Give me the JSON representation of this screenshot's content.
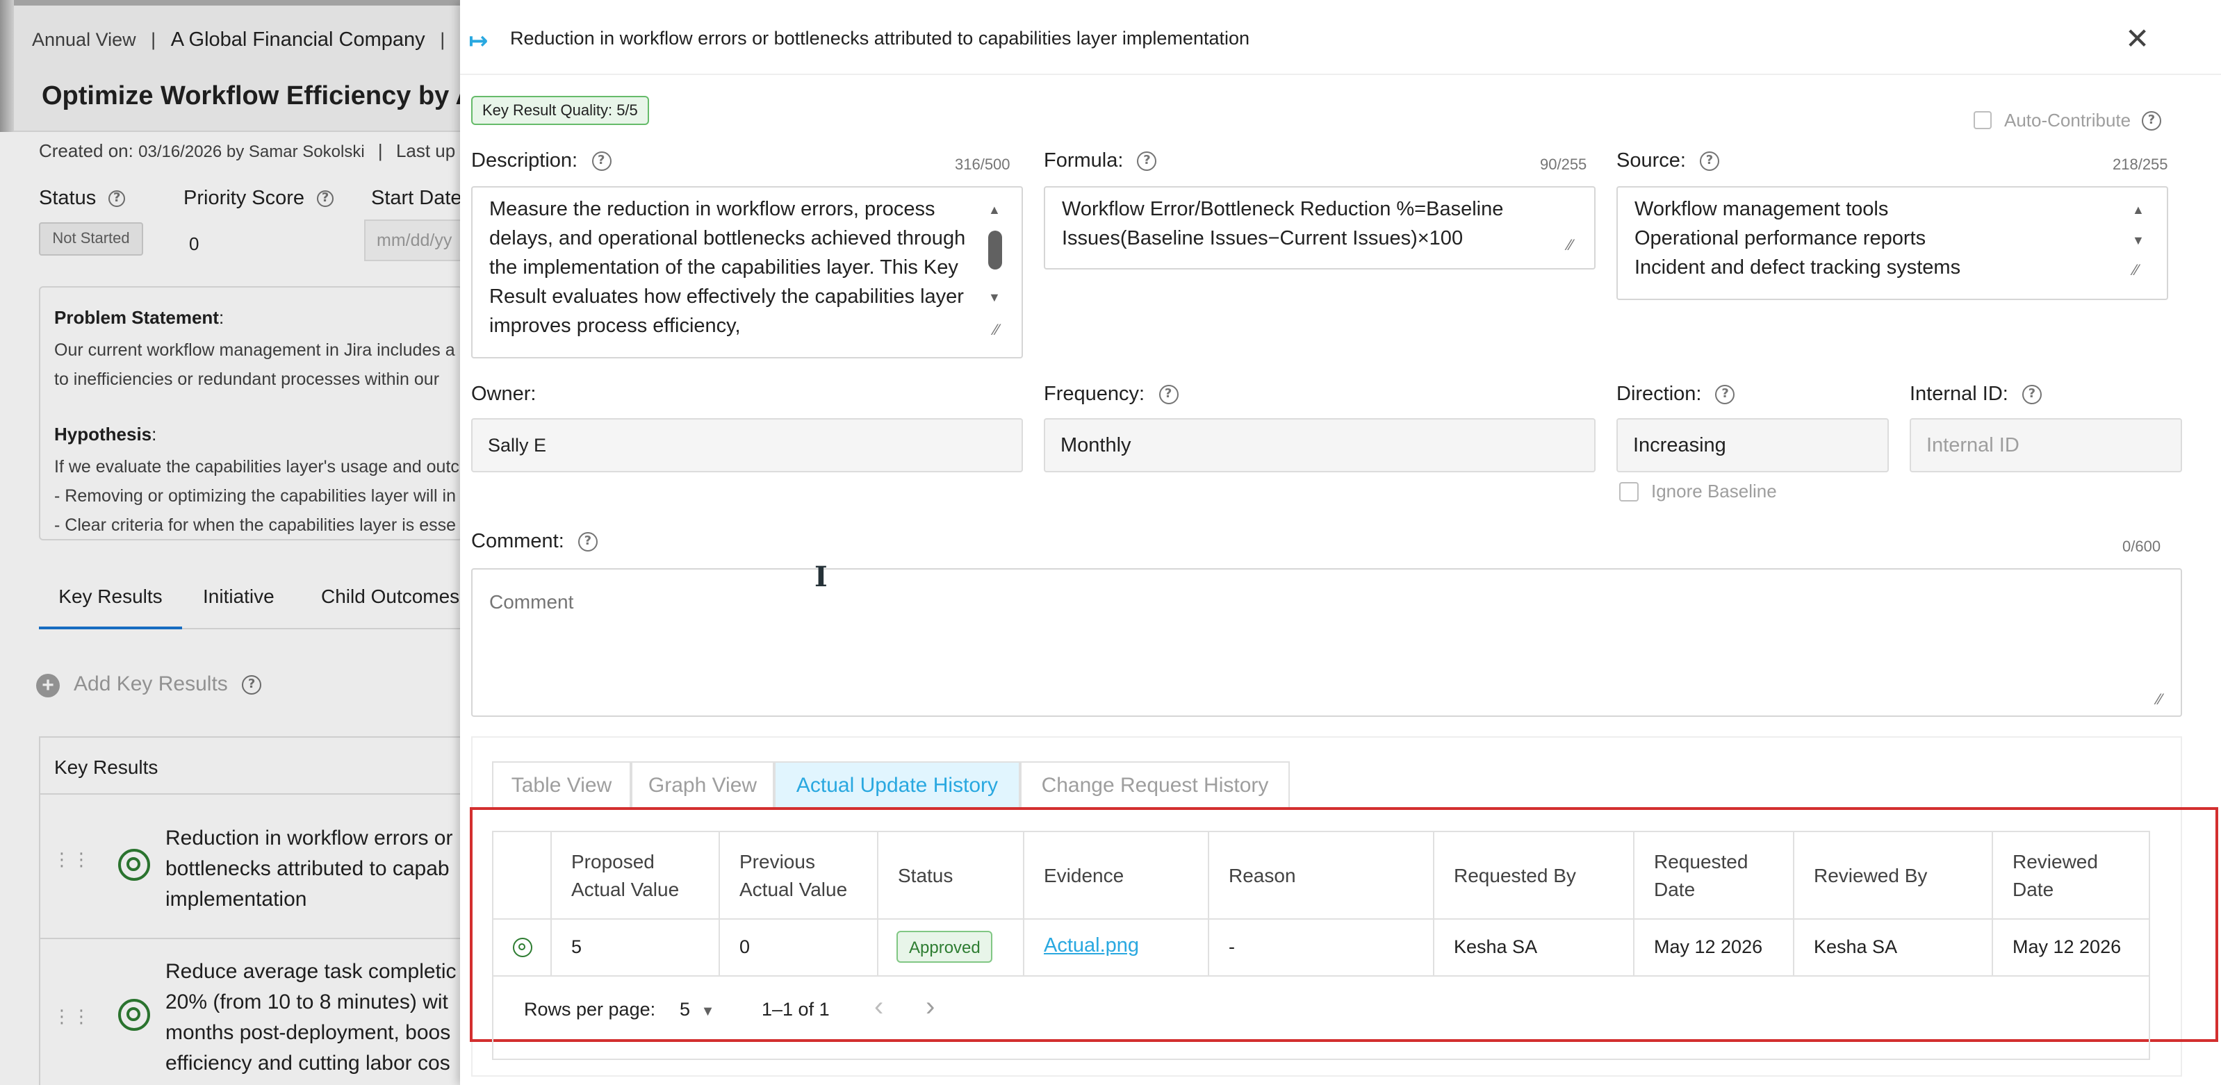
{
  "background": {
    "breadcrumb": {
      "view": "Annual View",
      "company": "A Global Financial Company",
      "sep": "|"
    },
    "objective_title": "Optimize Workflow Efficiency by As",
    "created_label": "Created on:",
    "created_value": "03/16/2026 by Samar Sokolski",
    "last_updated": "Last up",
    "status_label": "Status",
    "status_value": "Not Started",
    "priority_label": "Priority Score",
    "priority_value": "0",
    "start_label": "Start Date",
    "start_placeholder": "mm/dd/yy",
    "problem_label": "Problem Statement",
    "problem_text_1": "Our current workflow management in Jira includes a",
    "problem_text_2": "to inefficiencies or redundant processes within our",
    "hypothesis_label": "Hypothesis",
    "hypothesis_text_1": "If we evaluate the capabilities layer's usage and outc",
    "hypothesis_text_2": "- Removing or optimizing the capabilities layer will in",
    "hypothesis_text_3": "- Clear criteria for when the capabilities layer is esse",
    "tabs": [
      "Key Results",
      "Initiative",
      "Child Outcomes"
    ],
    "add_kr": "Add Key Results",
    "kr_header": "Key Results",
    "kr1_lines": [
      "Reduction in workflow errors or",
      "bottlenecks attributed to capab",
      "implementation"
    ],
    "kr2_lines": [
      "Reduce average task completic",
      "20% (from 10 to 8 minutes) wit",
      "months post-deployment, boos",
      "efficiency and cutting labor cos"
    ]
  },
  "panel": {
    "title": "Reduction in workflow errors or bottlenecks attributed to capabilities layer implementation",
    "quality_badge": "Key Result Quality: 5/5",
    "auto_contribute": "Auto-Contribute",
    "description_label": "Description:",
    "description_counter": "316/500",
    "description_text": "Measure the reduction in workflow errors, process delays, and operational bottlenecks achieved through the implementation of the capabilities layer. This Key Result evaluates how effectively the capabilities layer improves process efficiency,",
    "formula_label": "Formula:",
    "formula_counter": "90/255",
    "formula_text": "Workflow Error/Bottleneck Reduction %=Baseline Issues(Baseline Issues−Current Issues)×100",
    "source_label": "Source:",
    "source_counter": "218/255",
    "source_lines": [
      "Workflow management tools",
      "Operational performance reports",
      "Incident and defect tracking systems"
    ],
    "owner_label": "Owner:",
    "owner_value": "Sally E",
    "frequency_label": "Frequency:",
    "frequency_value": "Monthly",
    "direction_label": "Direction:",
    "direction_value": "Increasing",
    "internal_id_label": "Internal ID:",
    "internal_id_placeholder": "Internal ID",
    "ignore_baseline": "Ignore Baseline",
    "comment_label": "Comment:",
    "comment_counter": "0/600",
    "comment_placeholder": "Comment",
    "view_tabs": [
      "Table View",
      "Graph View",
      "Actual Update History",
      "Change Request History"
    ],
    "table": {
      "headers": [
        "Proposed Actual Value",
        "Previous Actual Value",
        "Status",
        "Evidence",
        "Reason",
        "Requested By",
        "Requested Date",
        "Reviewed By",
        "Reviewed Date"
      ],
      "row": {
        "proposed": "5",
        "previous": "0",
        "status": "Approved",
        "evidence": "Actual.png",
        "reason": "-",
        "requested_by": "Kesha SA",
        "requested_date": "May 12 2026",
        "reviewed_by": "Kesha SA",
        "reviewed_date": "May 12 2026"
      }
    },
    "pagination": {
      "rows_label": "Rows per page:",
      "rows_value": "5",
      "range": "1–1 of 1"
    }
  },
  "colors": {
    "accent": "#29a8e0",
    "highlight": "#d32f2f",
    "success_bg": "#e8f5e9",
    "success_text": "#2e7d32"
  }
}
